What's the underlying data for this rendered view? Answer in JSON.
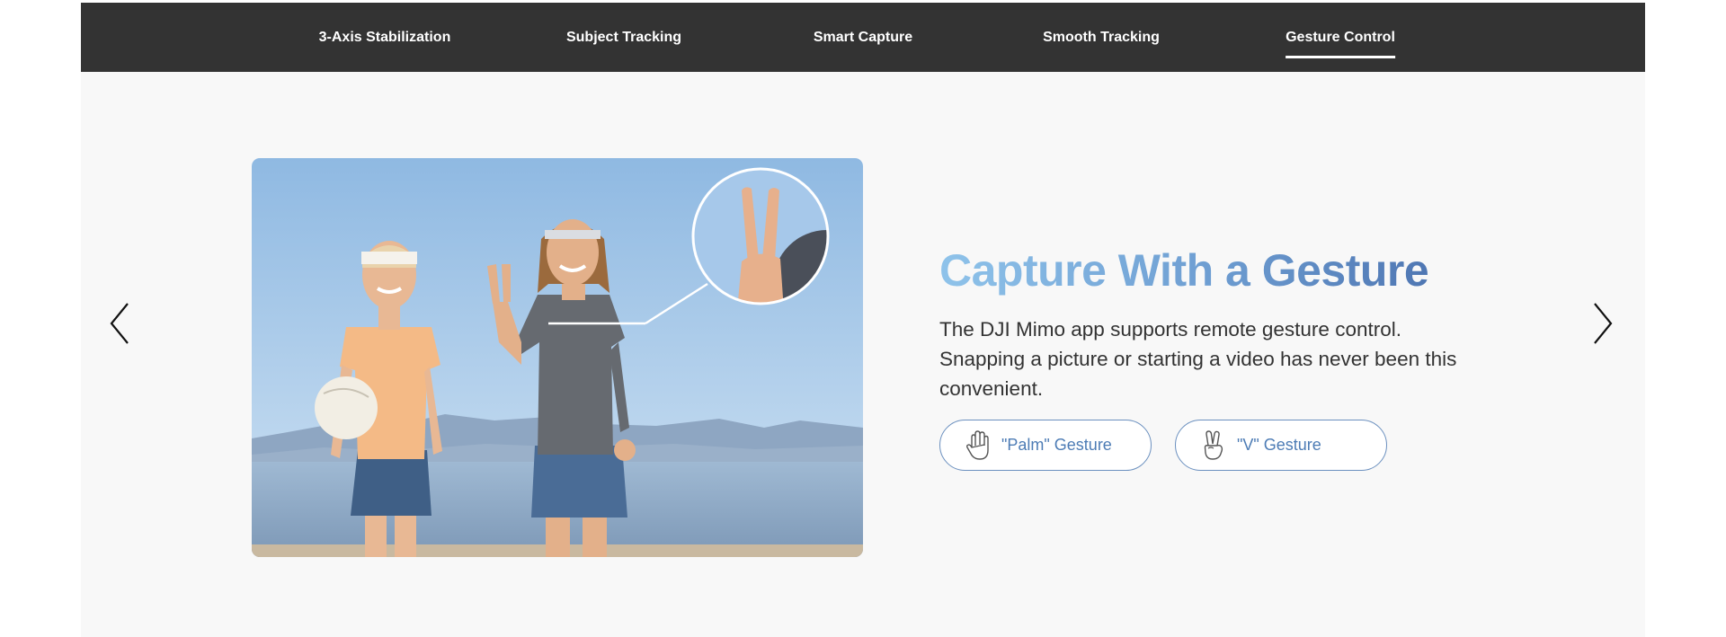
{
  "nav": {
    "tabs": [
      {
        "label": "3-Axis Stabilization",
        "active": false
      },
      {
        "label": "Subject Tracking",
        "active": false
      },
      {
        "label": "Smart Capture",
        "active": false
      },
      {
        "label": "Smooth Tracking",
        "active": false
      },
      {
        "label": "Gesture Control",
        "active": true
      }
    ]
  },
  "carousel": {
    "prev_icon": "chevron-left-icon",
    "next_icon": "chevron-right-icon"
  },
  "feature": {
    "title": "Capture With a Gesture",
    "description": "The DJI Mimo app supports remote gesture control. Snapping a picture or starting a video has never been this convenient.",
    "buttons": [
      {
        "label": "\"Palm\" Gesture",
        "icon": "palm-hand-icon"
      },
      {
        "label": "\"V\" Gesture",
        "icon": "v-sign-hand-icon"
      }
    ]
  },
  "colors": {
    "navbar": "#333333",
    "title_gradient_start": "#8fc3ea",
    "title_gradient_end": "#4f77b3",
    "button_border": "#6b90bf"
  }
}
